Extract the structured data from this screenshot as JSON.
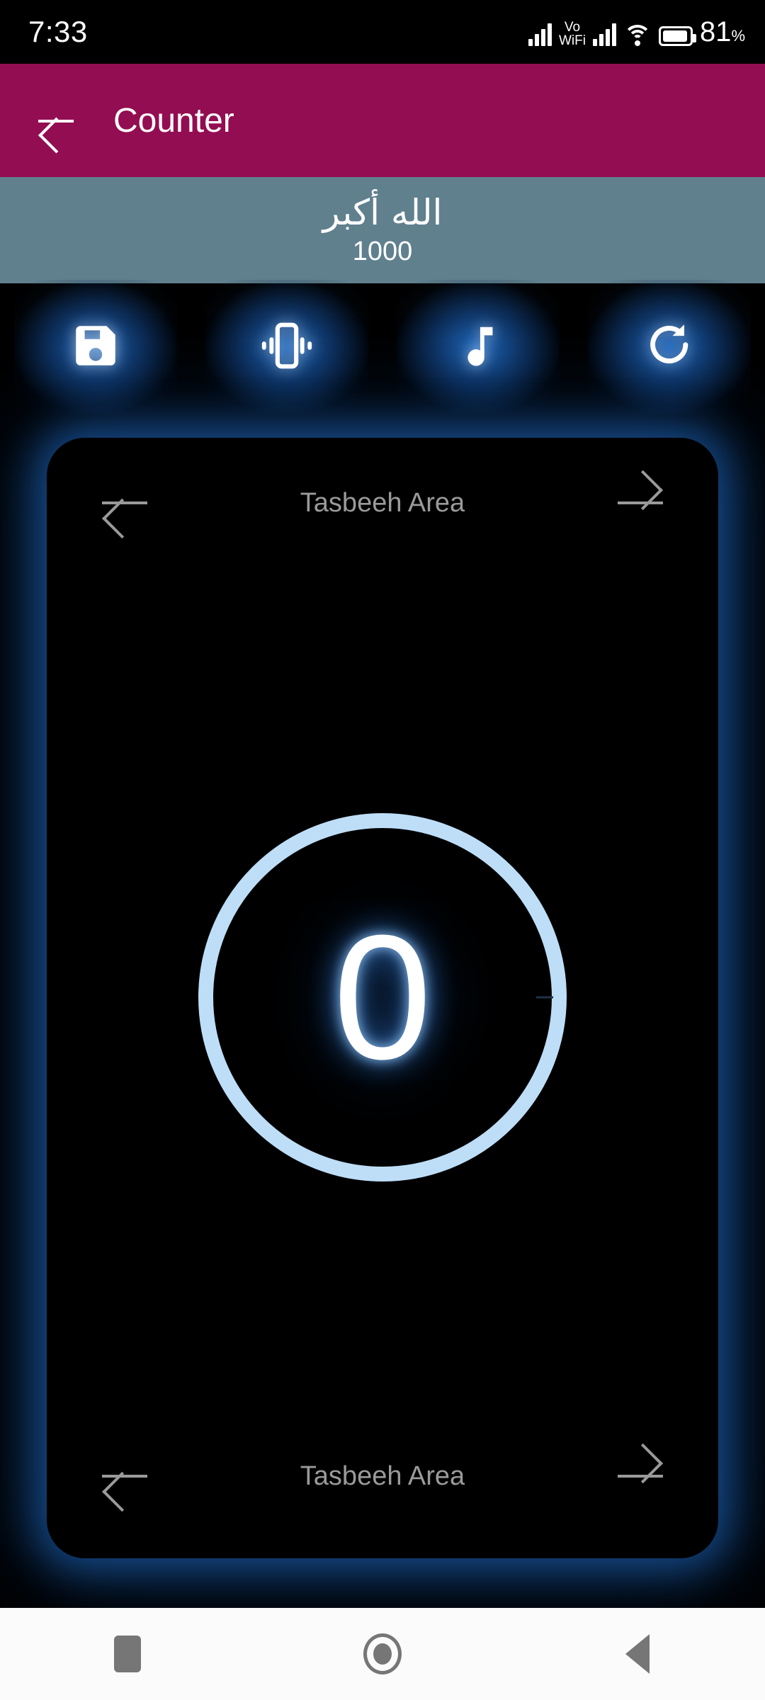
{
  "status_bar": {
    "time": "7:33",
    "vowifi_line1": "Vo",
    "vowifi_line2": "WiFi",
    "battery_percent": "81",
    "percent_symbol": "%",
    "icons": [
      "signal-bars",
      "vowifi-indicator",
      "signal-bars",
      "wifi-icon",
      "battery-icon"
    ]
  },
  "app_bar": {
    "title": "Counter",
    "back_icon": "arrow-left-icon",
    "background_color": "#930D52"
  },
  "banner": {
    "dhikr_arabic": "الله أكبر",
    "target_count": "1000",
    "background_color": "#60808E"
  },
  "toolbar": {
    "buttons": [
      {
        "name": "save",
        "icon": "floppy-disk-icon"
      },
      {
        "name": "vibrate",
        "icon": "vibration-icon"
      },
      {
        "name": "sound",
        "icon": "music-note-icon"
      },
      {
        "name": "reset",
        "icon": "refresh-icon"
      }
    ],
    "glow_color": "#216EC8"
  },
  "counter_card": {
    "top_nav": {
      "label": "Tasbeeh Area",
      "prev_icon": "arrow-left-icon",
      "next_icon": "arrow-right-icon"
    },
    "bottom_nav": {
      "label": "Tasbeeh Area",
      "prev_icon": "arrow-left-icon",
      "next_icon": "arrow-right-icon"
    },
    "counter_value": "0",
    "ring_color": "#BEDEF8",
    "glow_color": "#1C62B4"
  },
  "system_nav": {
    "recents_icon": "square-icon",
    "home_icon": "circle-icon",
    "back_icon": "triangle-back-icon"
  }
}
